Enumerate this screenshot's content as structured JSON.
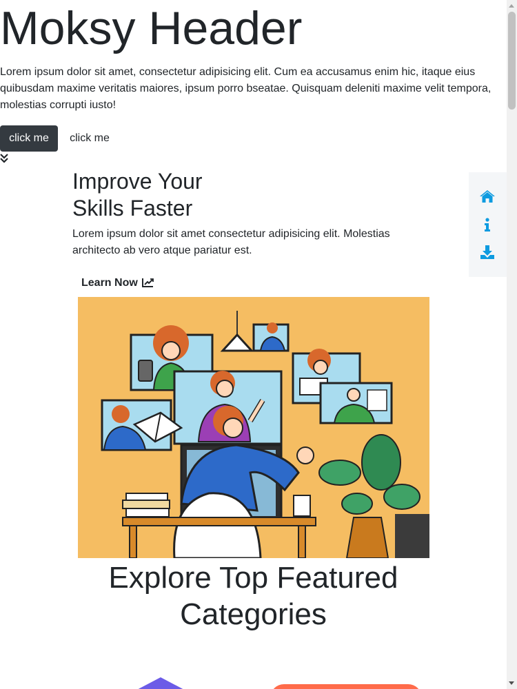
{
  "hero": {
    "title": "Moksy Header",
    "text": "Lorem ipsum dolor sit amet, consectetur adipisicing elit. Cum ea accusamus enim hic, itaque eius quibusdam maxime veritatis maiores, ipsum porro bseatae. Quisquam deleniti maxime velit tempora, molestias corrupti iusto!",
    "primary_button": "click me",
    "secondary_button": "click me",
    "scroll_icon": "angle-double-down-icon"
  },
  "skills": {
    "title_line1": "Improve Your",
    "title_line2": "Skills Faster",
    "text": "Lorem ipsum dolor sit amet consectetur adipisicing elit. Molestias architecto ab vero atque pariatur est.",
    "link_label": "Learn Now",
    "link_icon": "chart-line-icon",
    "illustration_bg": "#f5bd62"
  },
  "categories": {
    "title": "Explore Top Featured Categories"
  },
  "side_nav": {
    "icon_color": "#0d9be0",
    "items": [
      {
        "icon": "home-icon"
      },
      {
        "icon": "info-icon"
      },
      {
        "icon": "download-icon"
      }
    ]
  }
}
